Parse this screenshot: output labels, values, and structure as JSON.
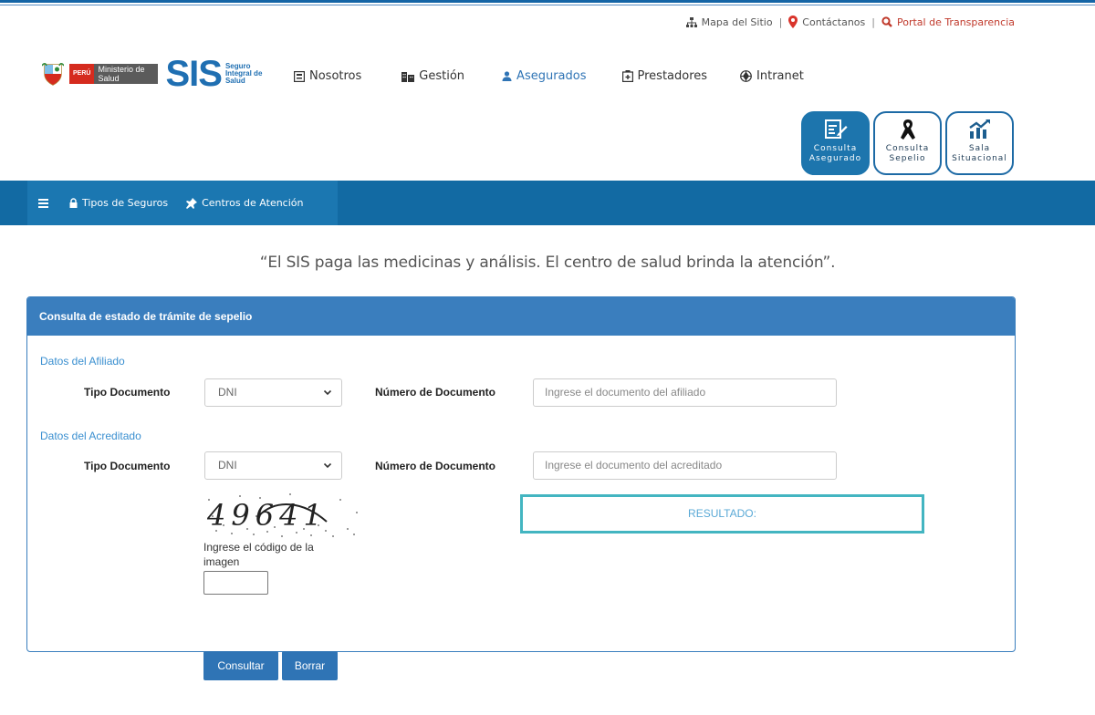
{
  "utility_links": {
    "sitemap": "Mapa del Sitio",
    "separator": "|",
    "contact": "Contáctanos",
    "transparency": "Portal de Transparencia"
  },
  "logos": {
    "peru": "PERÚ",
    "ministry": "Ministerio de Salud",
    "sis": "SIS",
    "sis_full": "Seguro Integral de Salud"
  },
  "main_nav": {
    "items": [
      "Nosotros",
      "Gestión",
      "Asegurados",
      "Prestadores",
      "Intranet"
    ],
    "active": "Asegurados"
  },
  "quick_buttons": [
    {
      "label": "Consulta Asegurado",
      "selected": true
    },
    {
      "label": "Consulta Sepelio",
      "selected": false
    },
    {
      "label": "Sala Situacional",
      "selected": false
    }
  ],
  "secondary_nav": {
    "items": [
      "Tipos de Seguros",
      "Centros de Atención"
    ]
  },
  "slogan": "“El SIS paga las medicinas y análisis. El centro de salud brinda la atención”.",
  "panel": {
    "title": "Consulta de estado de trámite de sepelio",
    "afiliado": {
      "section": "Datos del Afiliado",
      "tipo_label": "Tipo Documento",
      "tipo_value": "DNI",
      "numero_label": "Número de Documento",
      "numero_placeholder": "Ingrese el documento del afiliado"
    },
    "acreditado": {
      "section": "Datos del Acreditado",
      "tipo_label": "Tipo Documento",
      "tipo_value": "DNI",
      "numero_label": "Número de Documento",
      "numero_placeholder": "Ingrese el documento del acreditado"
    },
    "captcha_text": "49641",
    "captcha_label": "Ingrese el código de la imagen",
    "result_label": "RESULTADO:"
  },
  "buttons": {
    "consultar": "Consultar",
    "borrar": "Borrar"
  },
  "colors": {
    "primary": "#126aa3",
    "panel_header": "#3a7ebe",
    "accent_teal": "#43b5c1",
    "link_red": "#c0392b"
  }
}
